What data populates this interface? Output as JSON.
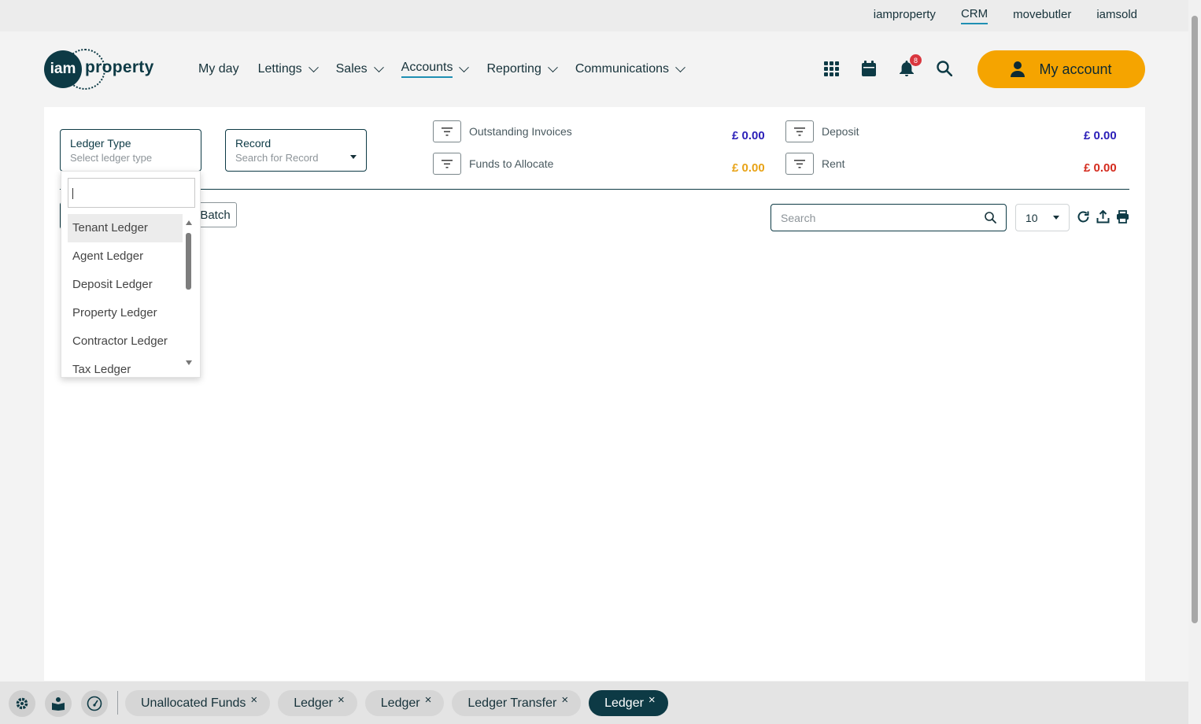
{
  "top_links": [
    {
      "label": "iamproperty",
      "active": false
    },
    {
      "label": "CRM",
      "active": true
    },
    {
      "label": "movebutler",
      "active": false
    },
    {
      "label": "iamsold",
      "active": false
    }
  ],
  "logo": {
    "circle_text": "iam",
    "word": "property"
  },
  "nav": [
    {
      "label": "My day",
      "has_menu": false,
      "active": false
    },
    {
      "label": "Lettings",
      "has_menu": true,
      "active": false
    },
    {
      "label": "Sales",
      "has_menu": true,
      "active": false
    },
    {
      "label": "Accounts",
      "has_menu": true,
      "active": true
    },
    {
      "label": "Reporting",
      "has_menu": true,
      "active": false
    },
    {
      "label": "Communications",
      "has_menu": true,
      "active": false
    }
  ],
  "header_icons": {
    "notification_count": "8"
  },
  "account_button": {
    "label": "My account"
  },
  "ledger_type": {
    "label": "Ledger Type",
    "placeholder": "Select ledger type"
  },
  "record": {
    "label": "Record",
    "placeholder": "Search for Record"
  },
  "stats": {
    "outstanding_invoices": {
      "label": "Outstanding Invoices",
      "value": "£ 0.00",
      "color": "#2b1fb8"
    },
    "funds_to_allocate": {
      "label": "Funds to Allocate",
      "value": "£ 0.00",
      "color": "#e8a317"
    },
    "deposit": {
      "label": "Deposit",
      "value": "£ 0.00",
      "color": "#2b1fb8"
    },
    "rent": {
      "label": "Rent",
      "value": "£ 0.00",
      "color": "#d42b1e"
    }
  },
  "batch_button": {
    "label": "Batch"
  },
  "table_search": {
    "placeholder": "Search"
  },
  "page_size": {
    "value": "10"
  },
  "dropdown": {
    "search_value": "",
    "items": [
      "Tenant Ledger",
      "Agent Ledger",
      "Deposit Ledger",
      "Property Ledger",
      "Contractor Ledger",
      "Tax Ledger"
    ],
    "highlighted": "Tenant Ledger"
  },
  "bottom_tabs": [
    {
      "label": "Unallocated Funds",
      "active": false
    },
    {
      "label": "Ledger",
      "active": false
    },
    {
      "label": "Ledger",
      "active": false
    },
    {
      "label": "Ledger Transfer",
      "active": false
    },
    {
      "label": "Ledger",
      "active": true
    }
  ],
  "close_glyph": "×"
}
